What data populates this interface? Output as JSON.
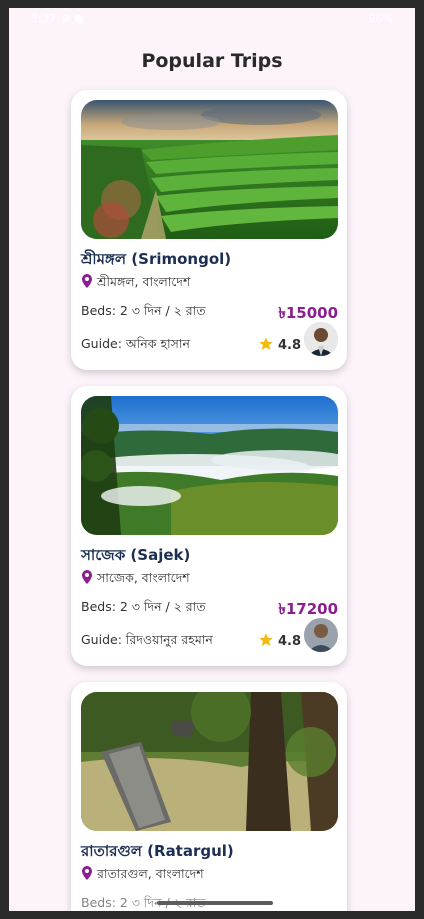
{
  "status_bar": {
    "time": "3:37",
    "right": "96%"
  },
  "page": {
    "title": "Popular Trips"
  },
  "trips": [
    {
      "name": "শ্রীমঙ্গল (Srimongol)",
      "location": "শ্রীমঙ্গল, বাংলাদেশ",
      "beds": "Beds: 2  ৩ দিন / ২ রাত",
      "price": "৳15000",
      "guide": "Guide: অনিক হাসান",
      "rating": "4.8"
    },
    {
      "name": "সাজেক (Sajek)",
      "location": "সাজেক, বাংলাদেশ",
      "beds": "Beds: 2  ৩ দিন / ২ রাত",
      "price": "৳17200",
      "guide": "Guide: রিদওয়ানুর রহমান",
      "rating": "4.8"
    },
    {
      "name": "রাতারগুল (Ratargul)",
      "location": "রাতারগুল, বাংলাদেশ",
      "beds": "Beds: 2  ৩ দিন / ২ রাত",
      "price": "",
      "guide": "",
      "rating": ""
    }
  ],
  "colors": {
    "price": "#8a1f8f",
    "title": "#1c2f52",
    "background": "#fdf3fb"
  }
}
